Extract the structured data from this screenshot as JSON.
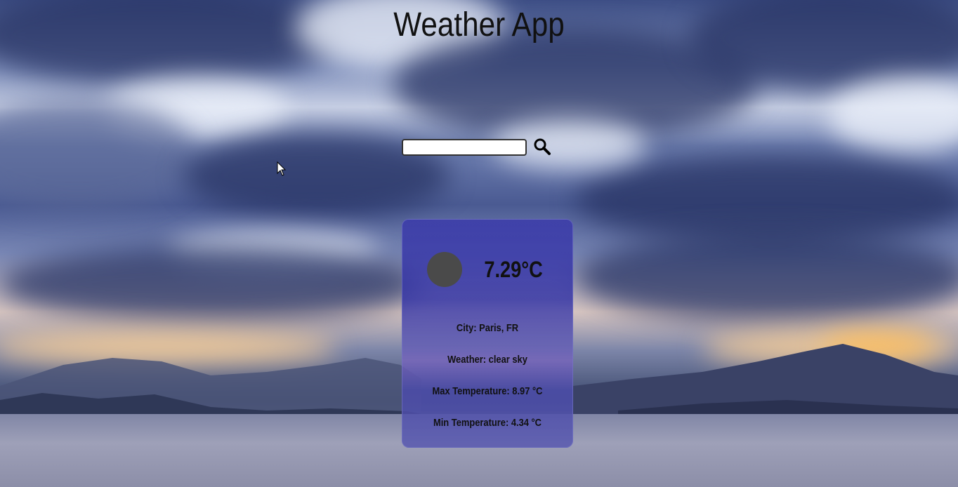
{
  "app": {
    "title": "Weather App"
  },
  "search": {
    "value": "",
    "placeholder": "",
    "icon": "search-icon"
  },
  "weather": {
    "icon": "weather-condition-icon",
    "temperature": "7.29°C",
    "city": "City: Paris, FR",
    "condition": "Weather: clear sky",
    "max_temp": "Max Temperature: 8.97 °C",
    "min_temp": "Min Temperature: 4.34 °C"
  },
  "colors": {
    "card_background": "#3c3caa",
    "text": "#111111",
    "icon_placeholder": "#4a4a4a"
  }
}
